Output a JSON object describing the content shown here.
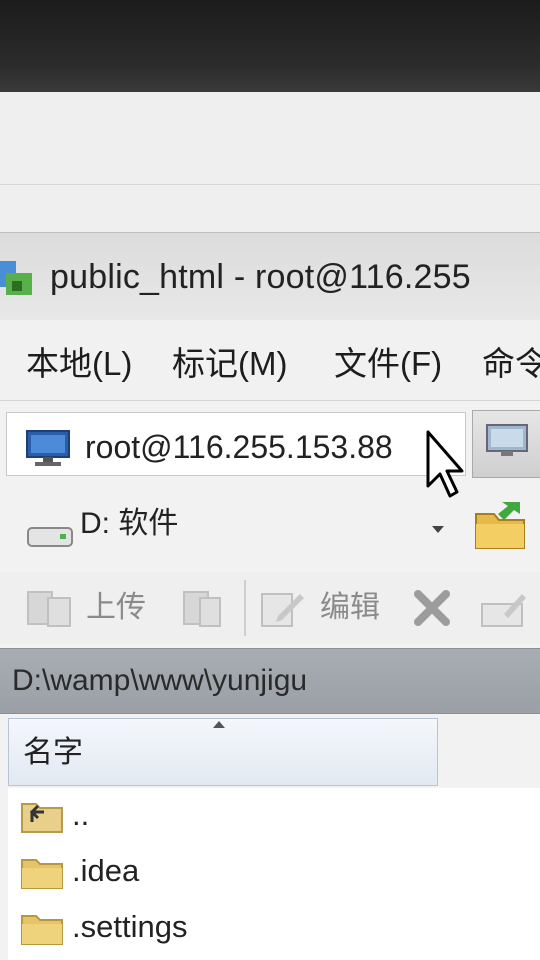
{
  "window": {
    "title": "public_html - root@116.255"
  },
  "menu": {
    "items": [
      "本地(L)",
      "标记(M)",
      "文件(F)",
      "命令"
    ]
  },
  "session": {
    "label": "root@116.255.153.88"
  },
  "drive": {
    "label": "D: 软件"
  },
  "toolbar": {
    "upload_label": "上传",
    "edit_label": "编辑"
  },
  "path": {
    "value": "D:\\wamp\\www\\yunjigu"
  },
  "list": {
    "header_name": "名字",
    "files": [
      {
        "name": "..",
        "icon": "parent-folder-icon"
      },
      {
        "name": ".idea",
        "icon": "folder-icon"
      },
      {
        "name": ".settings",
        "icon": "folder-icon"
      }
    ]
  },
  "colors": {
    "pathbar": "#9ea4aa",
    "header": "#e8eef5",
    "folder": "#e6c46a"
  }
}
